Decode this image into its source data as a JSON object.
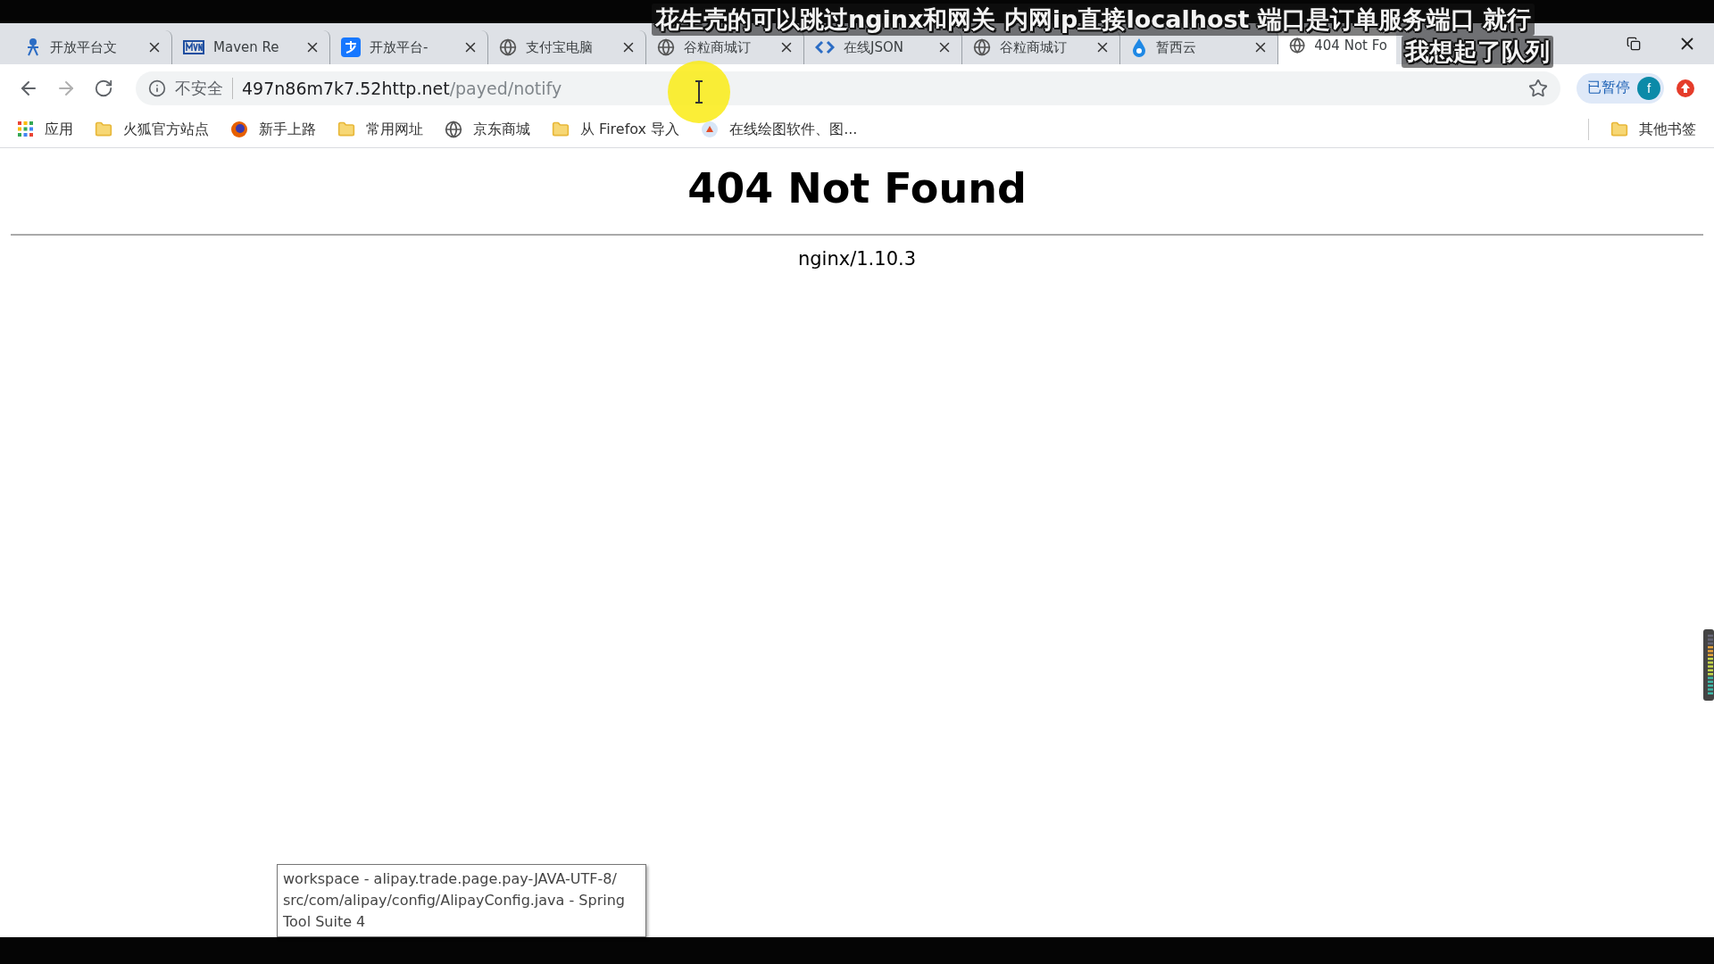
{
  "tabs": [
    {
      "kind": "figure",
      "title": "开放平台文",
      "selected": false
    },
    {
      "kind": "mvn",
      "title": "Maven Re",
      "selected": false
    },
    {
      "kind": "alipay",
      "title": "开放平台-",
      "selected": false
    },
    {
      "kind": "globe",
      "title": "支付宝电脑",
      "selected": false
    },
    {
      "kind": "globe",
      "title": "谷粒商城订",
      "selected": false
    },
    {
      "kind": "code",
      "title": "在线JSON",
      "selected": false
    },
    {
      "kind": "globe",
      "title": "谷粒商城订",
      "selected": false
    },
    {
      "kind": "cloud",
      "title": "暂西云",
      "selected": false
    },
    {
      "kind": "globe",
      "title": "404 Not Fo",
      "selected": true
    }
  ],
  "address_bar": {
    "security": "不安全",
    "host": "497n86m7k7.52http.net",
    "path": "/payed/notify"
  },
  "paused_button": "已暂停",
  "profile_initial": "f",
  "bookmarks": [
    {
      "kind": "apps",
      "label": "应用"
    },
    {
      "kind": "folder",
      "label": "火狐官方站点"
    },
    {
      "kind": "firefox",
      "label": "新手上路"
    },
    {
      "kind": "folder",
      "label": "常用网址"
    },
    {
      "kind": "globe",
      "label": "京东商城"
    },
    {
      "kind": "folder",
      "label": "从 Firefox 导入"
    },
    {
      "kind": "draw",
      "label": "在线绘图软件、图..."
    }
  ],
  "other_bookmarks": "其他书签",
  "page": {
    "heading": "404 Not Found",
    "server": "nginx/1.10.3"
  },
  "tooltip": [
    "workspace - alipay.trade.page.pay-JAVA-UTF-8/",
    "src/com/alipay/config/AlipayConfig.java - Spring",
    "Tool Suite 4"
  ],
  "subtitles": [
    "花生壳的可以跳过nginx和网关 内网ip直接localhost 端口是订单服务端口 就行",
    "我想起了队列"
  ]
}
